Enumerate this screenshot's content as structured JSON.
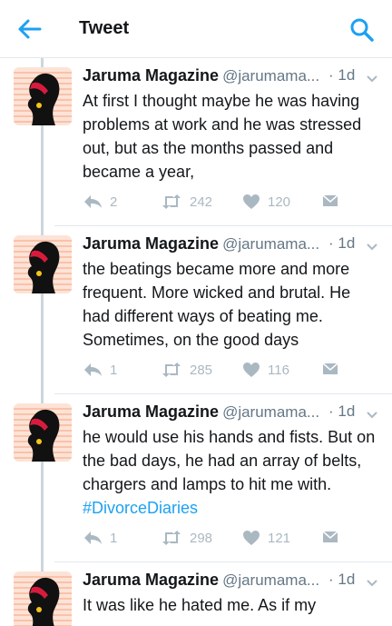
{
  "header": {
    "title": "Tweet",
    "back_icon": "back-arrow-icon",
    "search_icon": "search-icon",
    "accent": "#1da1f2"
  },
  "tweets": [
    {
      "name": "Jaruma Magazine",
      "handle": "@jarumama...",
      "time": "· 1d",
      "text": "At first I thought maybe he was having problems at work and he was stressed out, but as the months passed and became a year,",
      "hashtag": "",
      "replies": "2",
      "retweets": "242",
      "likes": "120"
    },
    {
      "name": "Jaruma Magazine",
      "handle": "@jarumama...",
      "time": "· 1d",
      "text": "the beatings became more and more frequent. More wicked and brutal. He had different ways of beating me. Sometimes, on the good days",
      "hashtag": "",
      "replies": "1",
      "retweets": "285",
      "likes": "116"
    },
    {
      "name": "Jaruma Magazine",
      "handle": "@jarumama...",
      "time": "· 1d",
      "text": "he would use his hands and fists. But on the bad days, he had an array of belts, chargers and lamps to hit me with. ",
      "hashtag": "#DivorceDiaries",
      "replies": "1",
      "retweets": "298",
      "likes": "121"
    },
    {
      "name": "Jaruma Magazine",
      "handle": "@jarumama...",
      "time": "· 1d",
      "text": "It was like he hated me. As if my",
      "hashtag": "",
      "replies": "",
      "retweets": "",
      "likes": ""
    }
  ],
  "colors": {
    "muted": "#657786",
    "icon": "#aab8c2",
    "thread_line": "#ccd6dd",
    "avatar_bg": "#fde3d7"
  }
}
